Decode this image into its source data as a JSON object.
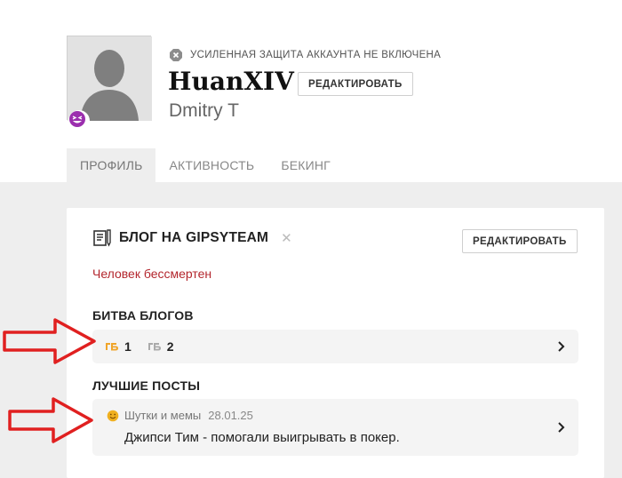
{
  "profile": {
    "security_notice": "УСИЛЕННАЯ ЗАЩИТА АККАУНТА НЕ ВКЛЮЧЕНА",
    "username": "HuanXIV",
    "edit_label": "РЕДАКТИРОВАТЬ",
    "real_name": "Dmitry T"
  },
  "tabs": [
    {
      "label": "ПРОФИЛЬ",
      "active": true
    },
    {
      "label": "АКТИВНОСТЬ",
      "active": false
    },
    {
      "label": "БЕКИНГ",
      "active": false
    }
  ],
  "blog": {
    "title": "БЛОГ НА GIPSYTEAM",
    "close": "✕",
    "edit_label": "РЕДАКТИРОВАТЬ",
    "slogan": "Человек бессмертен",
    "battle_label": "БИТВА БЛОГОВ",
    "battle": [
      {
        "value": "1",
        "color": "#f0a52a"
      },
      {
        "value": "2",
        "color": "#aaaaaa"
      }
    ],
    "best_posts_label": "ЛУЧШИЕ ПОСТЫ",
    "post": {
      "category": "Шутки и мемы",
      "date": "28.01.25",
      "title": "Джипси Тим - помогали выигрывать в покер."
    }
  },
  "colors": {
    "accent_red": "#b3262d",
    "badge_purple": "#8a2a9a",
    "arrow_red": "#e02020",
    "background": "#eeeeee"
  },
  "icons": [
    "security-off-icon",
    "avatar-silhouette",
    "laughing-emoji-icon",
    "blog-icon",
    "close-icon",
    "battle-badge-icon",
    "smile-icon",
    "chevron-right-icon",
    "red-arrow"
  ]
}
